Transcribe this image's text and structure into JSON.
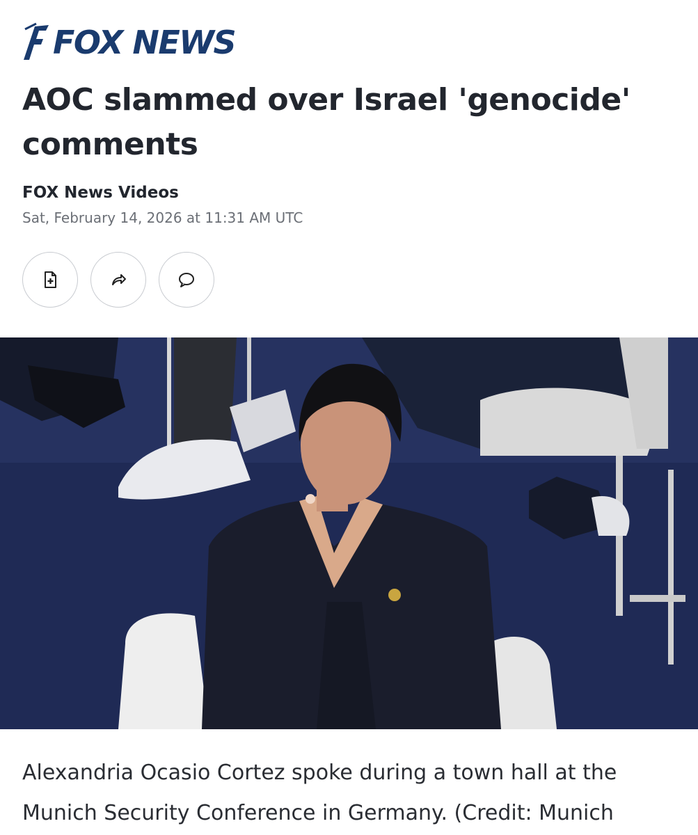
{
  "brand": {
    "name": "FOX NEWS",
    "color": "#1a3b6e"
  },
  "article": {
    "headline": "AOC slammed over Israel 'genocide' comments",
    "source": "FOX News Videos",
    "timestamp": "Sat, February 14, 2026 at 11:31 AM UTC",
    "caption": "Alexandria Ocasio Cortez spoke during a town hall at the Munich Security Conference in Germany. (Credit: Munich"
  },
  "actions": [
    {
      "icon": "add-document-icon"
    },
    {
      "icon": "share-arrow-icon"
    },
    {
      "icon": "comment-bubble-icon"
    }
  ],
  "photo": {
    "subject": "woman-seated-on-stage-photo"
  }
}
